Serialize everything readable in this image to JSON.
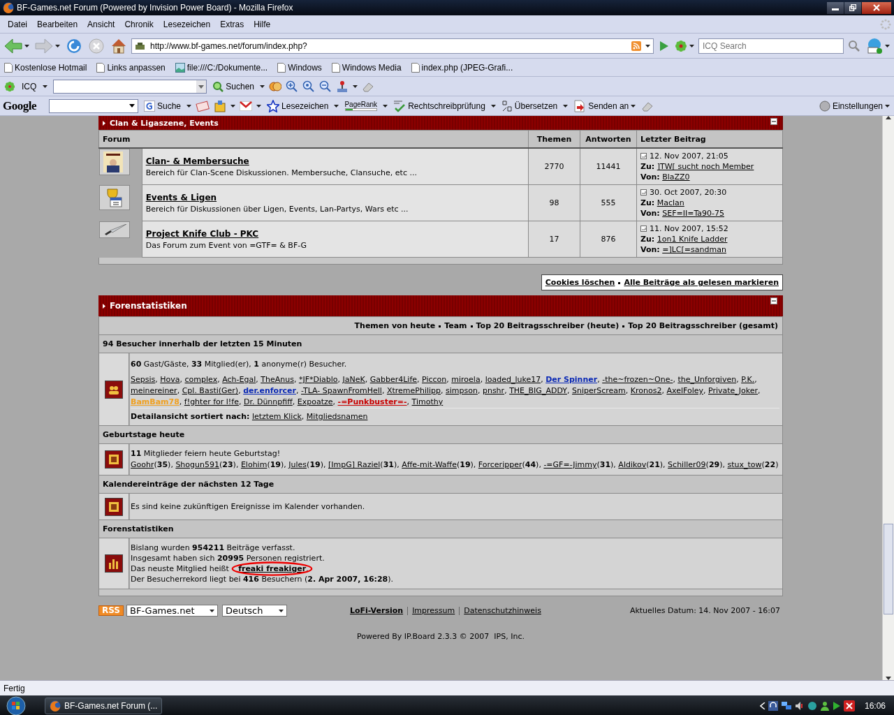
{
  "window": {
    "title": "BF-Games.net Forum (Powered by Invision Power Board) - Mozilla Firefox"
  },
  "menu": [
    "Datei",
    "Bearbeiten",
    "Ansicht",
    "Chronik",
    "Lesezeichen",
    "Extras",
    "Hilfe"
  ],
  "nav": {
    "url": "http://www.bf-games.net/forum/index.php?",
    "search_placeholder": "ICQ Search"
  },
  "bookmarks": [
    {
      "label": "Kostenlose Hotmail",
      "kind": "page"
    },
    {
      "label": "Links anpassen",
      "kind": "page"
    },
    {
      "label": "file:///C:/Dokumente...",
      "kind": "image"
    },
    {
      "label": "Windows",
      "kind": "page"
    },
    {
      "label": "Windows Media",
      "kind": "page"
    },
    {
      "label": "index.php (JPEG-Grafi...",
      "kind": "page"
    }
  ],
  "icq_toolbar": {
    "label": "ICQ",
    "search": "Suchen"
  },
  "google_toolbar": {
    "logo": "Google",
    "search": "Suche",
    "bookmarks": "Lesezeichen",
    "pagerank": "PageRank",
    "spell": "Rechtschreibprüfung",
    "translate": "Übersetzen",
    "send": "Senden an",
    "settings": "Einstellungen"
  },
  "forum": {
    "category": "Clan & Ligaszene, Events",
    "columns": [
      "Forum",
      "Themen",
      "Antworten",
      "Letzter Beitrag"
    ],
    "rows": [
      {
        "title": "Clan- & Membersuche",
        "description": "Bereich für Clan-Scene Diskussionen. Membersuche, Clansuche, etc ...",
        "topics": "2770",
        "replies": "11441",
        "last_date": "12. Nov 2007, 21:05",
        "to_label": "Zu:",
        "to": "]TW[ sucht noch Member",
        "by_label": "Von:",
        "by": "BlaZZ0"
      },
      {
        "title": "Events & Ligen",
        "description": "Bereich für Diskussionen über Ligen, Events, Lan-Partys, Wars etc ...",
        "topics": "98",
        "replies": "555",
        "last_date": "30. Oct 2007, 20:30",
        "to_label": "Zu:",
        "to": "Maclan",
        "by_label": "Von:",
        "by": "SEF=II=Ta90-75"
      },
      {
        "title": "Project Knife Club - PKC",
        "description": "Das Forum zum Event von =GTF= & BF-G",
        "topics": "17",
        "replies": "876",
        "last_date": "11. Nov 2007, 15:52",
        "to_label": "Zu:",
        "to": "1on1 Knife Ladder",
        "by_label": "Von:",
        "by": "=]LC[=sandman"
      }
    ]
  },
  "actions": [
    "Cookies löschen",
    "Alle Beiträge als gelesen markieren"
  ],
  "stats": {
    "title": "Forenstatistiken",
    "links": [
      "Themen von heute",
      "Team",
      "Top 20 Beitragsschreiber (heute)",
      "Top 20 Beitragsschreiber (gesamt)"
    ],
    "online": {
      "title": "94 Besucher innerhalb der letzten 15 Minuten",
      "summary": "**60** Gast/Gäste, **33** Mitglied(er), **1** anonyme(r) Besucher.",
      "members": [
        {
          "name": "Sepsis"
        },
        {
          "name": "Hova"
        },
        {
          "name": "complex"
        },
        {
          "name": "Ach-Egal"
        },
        {
          "name": "TheAnus"
        },
        {
          "name": "*JF*Diablo"
        },
        {
          "name": "JaNeK"
        },
        {
          "name": "Gabber4Life"
        },
        {
          "name": "Piccon"
        },
        {
          "name": "miroela"
        },
        {
          "name": "loaded_luke17"
        },
        {
          "name": "Der Spinner",
          "color": "#0a28b4"
        },
        {
          "name": "-the~frozen~One-"
        },
        {
          "name": "the_Unforgiven"
        },
        {
          "name": "P.K."
        },
        {
          "name": "meinereiner"
        },
        {
          "name": "Cpl. Basti(Ger)"
        },
        {
          "name": "der.enforcer",
          "color": "#0a28b4"
        },
        {
          "name": "-TLA- SpawnFromHell"
        },
        {
          "name": "XtremePhilipp"
        },
        {
          "name": "simpson"
        },
        {
          "name": "pnshr"
        },
        {
          "name": "THE_BIG_ADDY"
        },
        {
          "name": "SniperScream"
        },
        {
          "name": "Kronos2"
        },
        {
          "name": "AxelFoley"
        },
        {
          "name": "Private_Joker"
        },
        {
          "name": "BamBam78",
          "color": "#f0a020"
        },
        {
          "name": "f!ghter for l!fe"
        },
        {
          "name": "Dr. Dünnpfiff"
        },
        {
          "name": "Expoatze"
        },
        {
          "name": "-=Punkbuster=-",
          "color": "#c80000"
        },
        {
          "name": "Timothy"
        }
      ],
      "separator": ", ",
      "sort_label": "Detailansicht sortiert nach:",
      "sort_links": [
        "letztem Klick",
        "Mitgliedsnamen"
      ]
    },
    "birthdays": {
      "title": "Geburtstage heute",
      "summary": "**11** Mitglieder feiern heute Geburtstag!",
      "separator": ", ",
      "members": [
        {
          "name": "Goohr",
          "age": "(**35**)"
        },
        {
          "name": "Shogun591",
          "age": "(**23**)"
        },
        {
          "name": "Elohim",
          "age": "(**19**)"
        },
        {
          "name": "Jules",
          "age": "(**19**)"
        },
        {
          "name": "[ImpG] Raziel",
          "age": "(**31**)"
        },
        {
          "name": "Affe-mit-Waffe",
          "age": "(**19**)"
        },
        {
          "name": "Forceripper",
          "age": "(**44**)"
        },
        {
          "name": "-=GF=-Jimmy",
          "age": "(**31**)"
        },
        {
          "name": "Aldikov",
          "age": "(**21**)"
        },
        {
          "name": "Schiller09",
          "age": "(**29**)"
        },
        {
          "name": "stux_tow",
          "age": "(**22**)"
        }
      ]
    },
    "calendar": {
      "title": "Kalendereinträge der nächsten 12 Tage",
      "text": "Es sind keine zukünftigen Ereignisse im Kalender vorhanden."
    },
    "totals": {
      "title": "Forenstatistiken",
      "lines": [
        "Bislang wurden **954211** Beiträge verfasst.",
        "Insgesamt haben sich **20995** Personen registriert."
      ],
      "newest": {
        "prefix": "Das neuste Mitglied heißt",
        "name": "freaki freakiger",
        "suffix": ".",
        "circled": true
      },
      "record": "Der Besucherrekord liegt bei **416** Besuchern (**2. Apr 2007, 16:28**)."
    }
  },
  "footer": {
    "rss": "RSS",
    "skin": "BF-Games.net",
    "language": "Deutsch",
    "links": [
      "LoFi-Version",
      "Impressum",
      "Datenschutzhinweis"
    ],
    "date": "Aktuelles Datum: 14. Nov 2007 - 16:07",
    "powered": "Powered By IP.Board 2.3.3 © 2007  IPS, Inc."
  },
  "status_bar": {
    "text": "Fertig"
  },
  "taskbar": {
    "task": "BF-Games.net Forum (...",
    "clock": "16:06"
  }
}
